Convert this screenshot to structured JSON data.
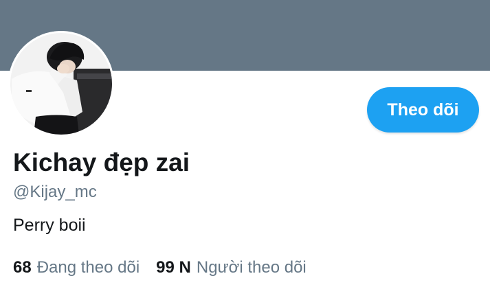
{
  "profile": {
    "display_name": "Kichay đẹp zai",
    "handle": "@Kijay_mc",
    "bio": "Perry boii"
  },
  "follow_button": {
    "label": "Theo dõi"
  },
  "stats": {
    "following_count": "68",
    "following_label": "Đang theo dõi",
    "followers_count": "99 N",
    "followers_label": "Người theo dõi"
  },
  "colors": {
    "banner": "#657786",
    "accent": "#1da1f2",
    "text_primary": "#14171a",
    "text_secondary": "#657786"
  },
  "icons": {
    "avatar": "profile-photo"
  }
}
